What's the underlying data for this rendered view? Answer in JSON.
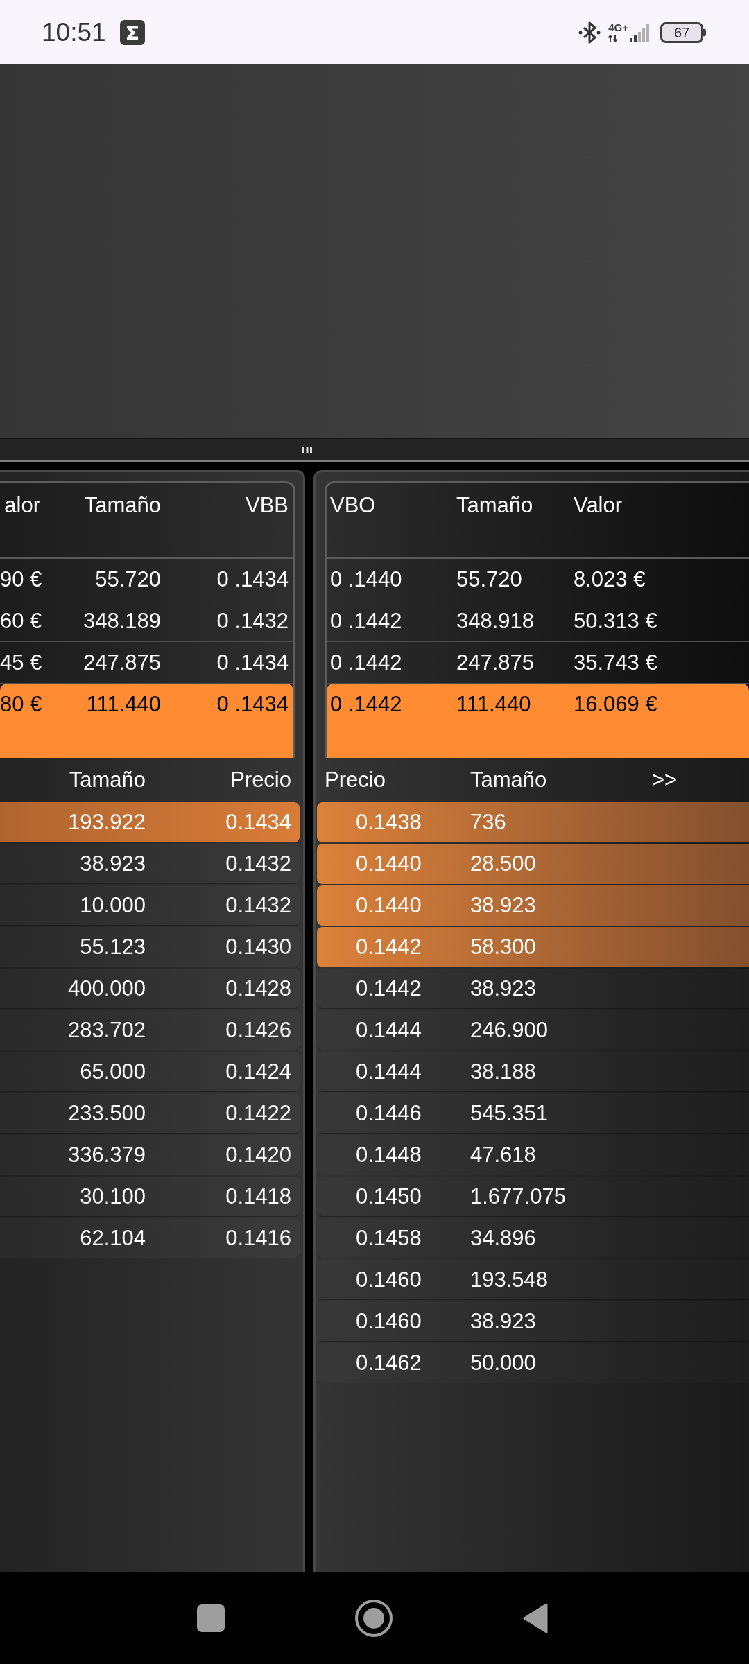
{
  "status_bar": {
    "time": "10:51",
    "network_type": "4G+",
    "battery": "67"
  },
  "bid_panel": {
    "summary": {
      "columns": [
        "alor",
        "Tamaño",
        "VBB"
      ],
      "rows": [
        {
          "cells": [
            "90 €",
            "55.720",
            "0 .1434"
          ],
          "highlighted": false
        },
        {
          "cells": [
            "60 €",
            "348.189",
            "0 .1432"
          ],
          "highlighted": false
        },
        {
          "cells": [
            "45 €",
            "247.875",
            "0 .1434"
          ],
          "highlighted": false
        },
        {
          "cells": [
            "80 €",
            "111.440",
            "0 .1434"
          ],
          "highlighted": true
        }
      ]
    },
    "depth": {
      "columns": [
        "Tamaño",
        "Precio"
      ],
      "rows": [
        {
          "cells": [
            "193.922",
            "0.1434"
          ],
          "highlighted": true
        },
        {
          "cells": [
            "38.923",
            "0.1432"
          ],
          "highlighted": false
        },
        {
          "cells": [
            "10.000",
            "0.1432"
          ],
          "highlighted": false
        },
        {
          "cells": [
            "55.123",
            "0.1430"
          ],
          "highlighted": false
        },
        {
          "cells": [
            "400.000",
            "0.1428"
          ],
          "highlighted": false
        },
        {
          "cells": [
            "283.702",
            "0.1426"
          ],
          "highlighted": false
        },
        {
          "cells": [
            "65.000",
            "0.1424"
          ],
          "highlighted": false
        },
        {
          "cells": [
            "233.500",
            "0.1422"
          ],
          "highlighted": false
        },
        {
          "cells": [
            "336.379",
            "0.1420"
          ],
          "highlighted": false
        },
        {
          "cells": [
            "30.100",
            "0.1418"
          ],
          "highlighted": false
        },
        {
          "cells": [
            "62.104",
            "0.1416"
          ],
          "highlighted": false
        }
      ]
    }
  },
  "ask_panel": {
    "summary": {
      "columns": [
        "VBO",
        "Tamaño",
        "Valor"
      ],
      "rows": [
        {
          "cells": [
            "0 .1440",
            "55.720",
            "8.023 €"
          ],
          "highlighted": false
        },
        {
          "cells": [
            "0 .1442",
            "348.918",
            "50.313 €"
          ],
          "highlighted": false
        },
        {
          "cells": [
            "0 .1442",
            "247.875",
            "35.743 €"
          ],
          "highlighted": false
        },
        {
          "cells": [
            "0 .1442",
            "111.440",
            "16.069 €"
          ],
          "highlighted": true
        }
      ]
    },
    "depth": {
      "columns": [
        "Precio",
        "Tamaño"
      ],
      "more_button": ">>",
      "rows": [
        {
          "cells": [
            "0.1438",
            "736"
          ],
          "highlighted": true
        },
        {
          "cells": [
            "0.1440",
            "28.500"
          ],
          "highlighted": true
        },
        {
          "cells": [
            "0.1440",
            "38.923"
          ],
          "highlighted": true
        },
        {
          "cells": [
            "0.1442",
            "58.300"
          ],
          "highlighted": true
        },
        {
          "cells": [
            "0.1442",
            "38.923"
          ],
          "highlighted": false
        },
        {
          "cells": [
            "0.1444",
            "246.900"
          ],
          "highlighted": false
        },
        {
          "cells": [
            "0.1444",
            "38.188"
          ],
          "highlighted": false
        },
        {
          "cells": [
            "0.1446",
            "545.351"
          ],
          "highlighted": false
        },
        {
          "cells": [
            "0.1448",
            "47.618"
          ],
          "highlighted": false
        },
        {
          "cells": [
            "0.1450",
            "1.677.075"
          ],
          "highlighted": false
        },
        {
          "cells": [
            "0.1458",
            "34.896"
          ],
          "highlighted": false
        },
        {
          "cells": [
            "0.1460",
            "193.548"
          ],
          "highlighted": false
        },
        {
          "cells": [
            "0.1460",
            "38.923"
          ],
          "highlighted": false
        },
        {
          "cells": [
            "0.1462",
            "50.000"
          ],
          "highlighted": false
        }
      ]
    }
  }
}
